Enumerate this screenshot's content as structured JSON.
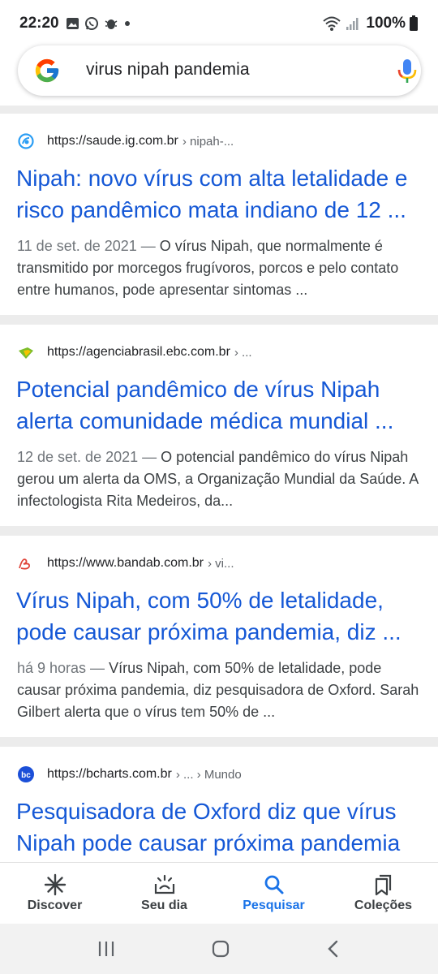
{
  "status_bar": {
    "time": "22:20",
    "battery": "100%"
  },
  "search": {
    "query": "virus nipah pandemia"
  },
  "results": [
    {
      "url": "https://saude.ig.com.br",
      "path": "› nipah-...",
      "title": "Nipah: novo vírus com alta letalidade e risco pandêmico mata indiano de 12 ...",
      "date": "11 de set. de 2021 —",
      "snippet": " O vírus Nipah, que normalmente é transmitido por morcegos frugívoros, porcos e pelo contato entre humanos, pode apresentar sintomas ..."
    },
    {
      "url": "https://agenciabrasil.ebc.com.br",
      "path": "› ...",
      "title": "Potencial pandêmico de vírus Nipah alerta comunidade médica mundial ...",
      "date": "12 de set. de 2021 —",
      "snippet": " O potencial pandêmico do vírus Nipah gerou um alerta da OMS, a Organização Mundial da Saúde. A infectologista Rita Medeiros, da..."
    },
    {
      "url": "https://www.bandab.com.br",
      "path": "› vi...",
      "title": "Vírus Nipah, com 50% de letalidade, pode causar próxima pandemia, diz ...",
      "date": "há 9 horas —",
      "snippet": " Vírus Nipah, com 50% de letalidade, pode causar próxima pandemia, diz pesquisadora de Oxford. Sarah Gilbert alerta que o vírus tem 50% de ..."
    },
    {
      "url": "https://bcharts.com.br",
      "path": "› ... › Mundo",
      "title": "Pesquisadora de Oxford diz que vírus Nipah pode causar próxima pandemia",
      "date": "",
      "snippet": ""
    }
  ],
  "bottom_nav": {
    "items": [
      {
        "label": "Discover",
        "icon": "asterisk-icon"
      },
      {
        "label": "Seu dia",
        "icon": "sunrise-icon"
      },
      {
        "label": "Pesquisar",
        "icon": "search-icon"
      },
      {
        "label": "Coleções",
        "icon": "collections-icon"
      }
    ],
    "active": "Pesquisar"
  },
  "colors": {
    "link": "#1558d6",
    "active_nav": "#1a73e8",
    "card": "#ffffff",
    "separator": "#ececec"
  }
}
